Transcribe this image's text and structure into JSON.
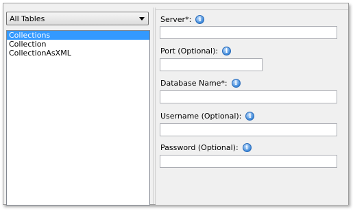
{
  "left": {
    "table_filter": {
      "selected": "All Tables"
    },
    "tables": [
      {
        "label": "Collections",
        "selected": true
      },
      {
        "label": "Collection",
        "selected": false
      },
      {
        "label": "CollectionAsXML",
        "selected": false
      }
    ]
  },
  "form": {
    "server": {
      "label": "Server*:",
      "value": ""
    },
    "port": {
      "label": "Port (Optional):",
      "value": ""
    },
    "database": {
      "label": "Database Name*:",
      "value": ""
    },
    "username": {
      "label": "Username (Optional):",
      "value": ""
    },
    "password": {
      "label": "Password (Optional):",
      "value": ""
    }
  },
  "icons": {
    "info": "info-icon",
    "dropdown": "chevron-down-icon"
  },
  "colors": {
    "selection": "#3399ff",
    "info_icon": "#3b87d9"
  }
}
